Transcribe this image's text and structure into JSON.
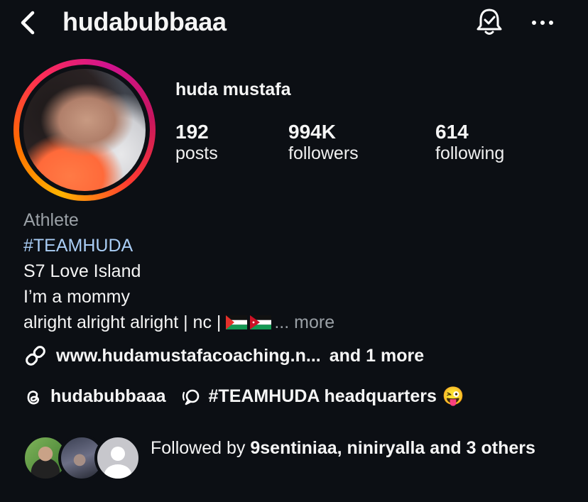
{
  "header": {
    "username": "hudabubbaaa",
    "back_icon": "chevron-left-icon",
    "bell_icon": "bell-check-icon",
    "more_icon": "ellipsis-icon"
  },
  "profile": {
    "display_name": "huda mustafa",
    "stats": [
      {
        "value": "192",
        "label": "posts"
      },
      {
        "value": "994K",
        "label": "followers"
      },
      {
        "value": "614",
        "label": "following"
      }
    ]
  },
  "bio": {
    "category": "Athlete",
    "hashtag": "#TEAMHUDA",
    "lines": [
      "S7 Love Island",
      "I’m a mommy"
    ],
    "last_line": "alright alright alright | nc | ",
    "ellipsis": "...",
    "more": "more"
  },
  "link": {
    "url": "www.hudamustafacoaching.n...",
    "extra": "and 1 more"
  },
  "threads": {
    "username": "hudabubbaaa",
    "channel": "#TEAMHUDA headquarters",
    "emoji": "😜"
  },
  "followed_by": {
    "prefix": "Followed by ",
    "names": "9sentiniaa, niniryalla",
    "suffix": " and 3 others"
  },
  "colors": {
    "background": "#0c0f14",
    "hashtag": "#a9cdf5",
    "muted": "#9aa0a6"
  }
}
